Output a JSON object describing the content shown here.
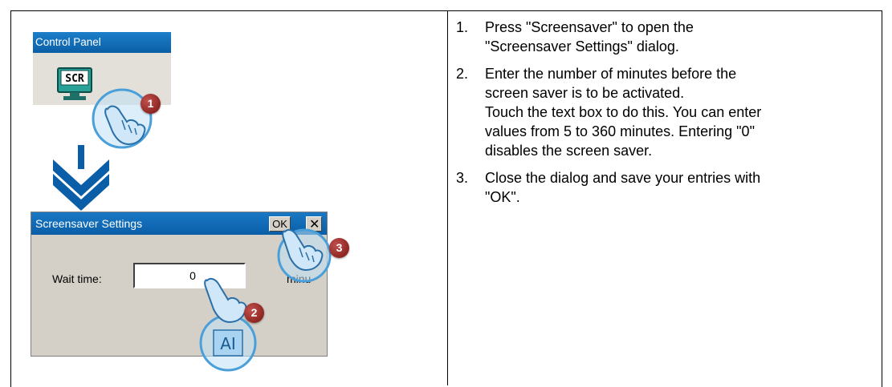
{
  "control_panel": {
    "title": "Control Panel",
    "icon_text": "SCR"
  },
  "dialog": {
    "title": "Screensaver Settings",
    "ok_label": "OK",
    "wait_label": "Wait time:",
    "wait_value": "0",
    "unit_label": "minu"
  },
  "badges": [
    "1",
    "2",
    "3"
  ],
  "steps": [
    {
      "number": "1.",
      "lines": [
        "Press \"Screensaver\" to open the",
        "\"Screensaver Settings\" dialog."
      ]
    },
    {
      "number": "2.",
      "lines": [
        "Enter the number of minutes before the",
        "screen saver is to be activated.",
        "Touch the text box to do this. You can enter",
        "values from 5 to 360 minutes. Entering \"0\"",
        "disables the screen saver."
      ]
    },
    {
      "number": "3.",
      "lines": [
        "Close the dialog and save your entries with",
        "\"OK\"."
      ]
    }
  ],
  "colors": {
    "titlebar": "#0b5fa6",
    "arrow": "#0a5ea8",
    "badge": "#9b2a24",
    "hand_ring": "#4a9fd8"
  }
}
